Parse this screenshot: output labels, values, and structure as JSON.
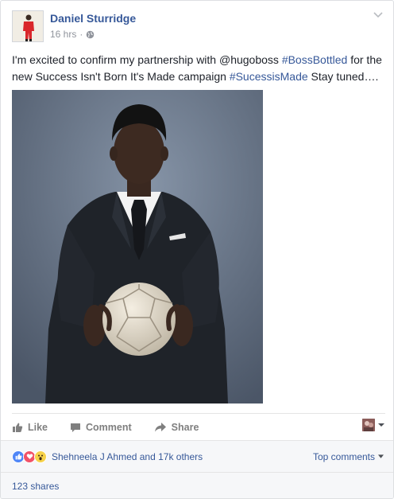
{
  "post": {
    "author": "Daniel Sturridge",
    "time": "16 hrs",
    "separator": "·",
    "text": {
      "part1": "I'm excited to confirm my partnership with @hugoboss ",
      "hashtag1": "#BossBottled",
      "part2": " for the new Success Isn't Born It's Made campaign ",
      "hashtag2": "#SucessisMade",
      "part3": " Stay tuned…."
    }
  },
  "actions": {
    "like": "Like",
    "comment": "Comment",
    "share": "Share"
  },
  "reactions": {
    "summary": "Shehneela J Ahmed and 17k others",
    "sort_label": "Top comments"
  },
  "shares": {
    "label": "123 shares"
  },
  "colors": {
    "link": "#365899",
    "text": "#1d2129",
    "muted": "#90949c",
    "action": "#7f7f7f",
    "bar_bg": "#f6f7f9"
  }
}
